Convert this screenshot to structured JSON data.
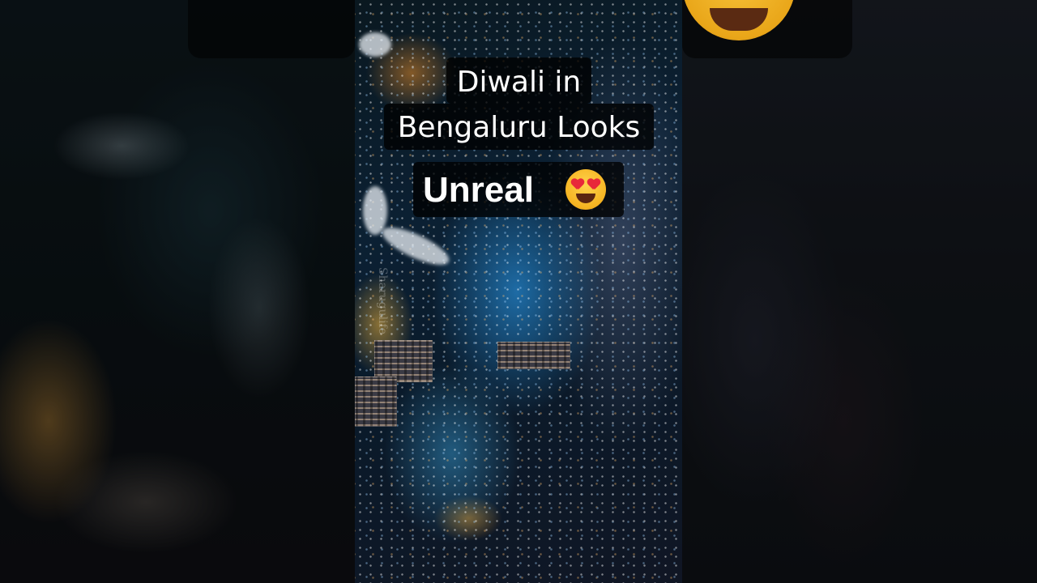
{
  "caption": {
    "line1": "Diwali in",
    "line2": "Bengaluru Looks",
    "line3": "Unreal"
  },
  "emoji": "heart-eyes-emoji",
  "watermark": "Sharugulife",
  "colors": {
    "caption_bg": "#000000",
    "caption_text": "#ffffff",
    "city_glow": "#2896e6"
  }
}
